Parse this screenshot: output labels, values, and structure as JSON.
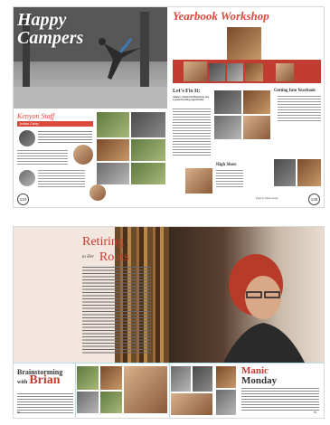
{
  "spread1": {
    "left_title_line1": "Happy",
    "left_title_line2": "Campers",
    "section_heading": "Kenyon Staff",
    "section_subheading": "Jordan Camp",
    "page_left_number": "134",
    "right_banner": "Yearbook Workshop",
    "sidebar1_heading": "Let's Fix It:",
    "sidebar1_sub": "Jamie's Yearbook Workshop has a great bonding opportunity",
    "sidebar2_heading": "Getting Into Yearbook",
    "sidebar2_sub": "High Shots",
    "page_right_number": "135",
    "credit": "Page by Marie Gorge"
  },
  "spread2": {
    "title_retiring": "Retiring",
    "title_to_her": "to Her",
    "title_roots": "Roots",
    "brainstorming_line1": "Brainstorming",
    "brainstorming_with": "with",
    "brainstorming_name": "Brian",
    "manic_line1": "Manic",
    "manic_line2": "Monday",
    "page_left_number": "88",
    "page_right_number": "89"
  },
  "colors": {
    "accent_red": "#d94a3c",
    "dark_red": "#b73a2e"
  }
}
